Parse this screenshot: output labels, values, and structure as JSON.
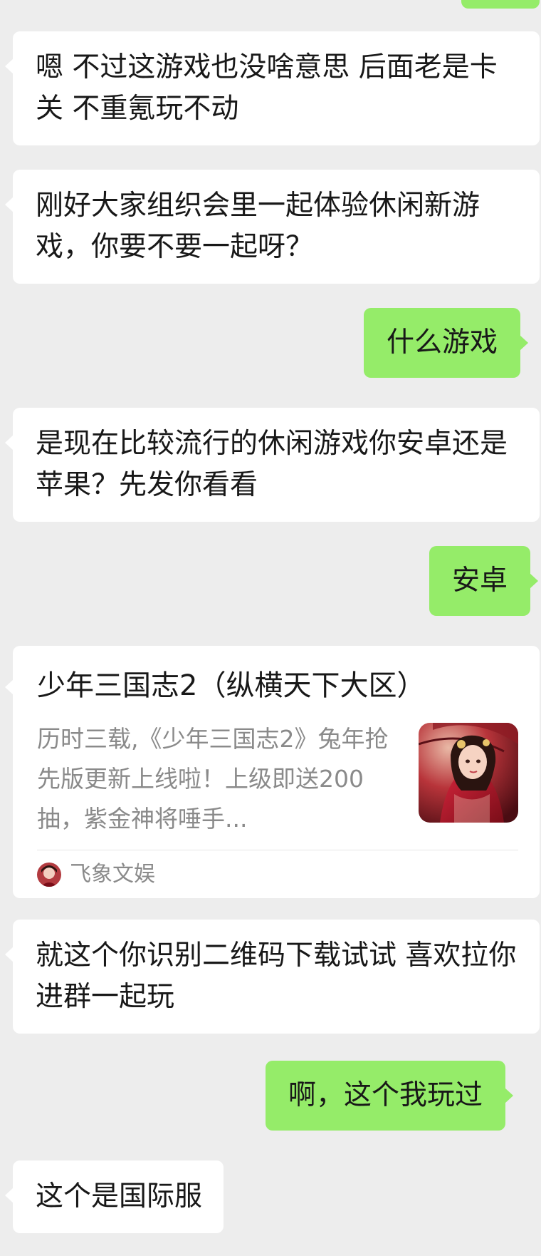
{
  "messages": {
    "m1": "嗯 不过这游戏也没啥意思 后面老是卡关 不重氪玩不动",
    "m2": "刚好大家组织会里一起体验休闲新游戏，你要不要一起呀？",
    "m3": "什么游戏",
    "m4": "是现在比较流行的休闲游戏你安卓还是苹果？先发你看看",
    "m5": "安卓",
    "m7": "就这个你识别二维码下载试试 喜欢拉你进群一起玩",
    "m8": "啊，这个我玩过",
    "m9": "这个是国际服"
  },
  "card": {
    "title": "少年三国志2（纵横天下大区）",
    "description": "历时三载,《少年三国志2》兔年抢先版更新上线啦！上级即送200抽，紫金神将唾手...",
    "source": "飞象文娱"
  },
  "colors": {
    "background": "#ededed",
    "incoming_bubble": "#ffffff",
    "outgoing_bubble": "#95ec69"
  }
}
